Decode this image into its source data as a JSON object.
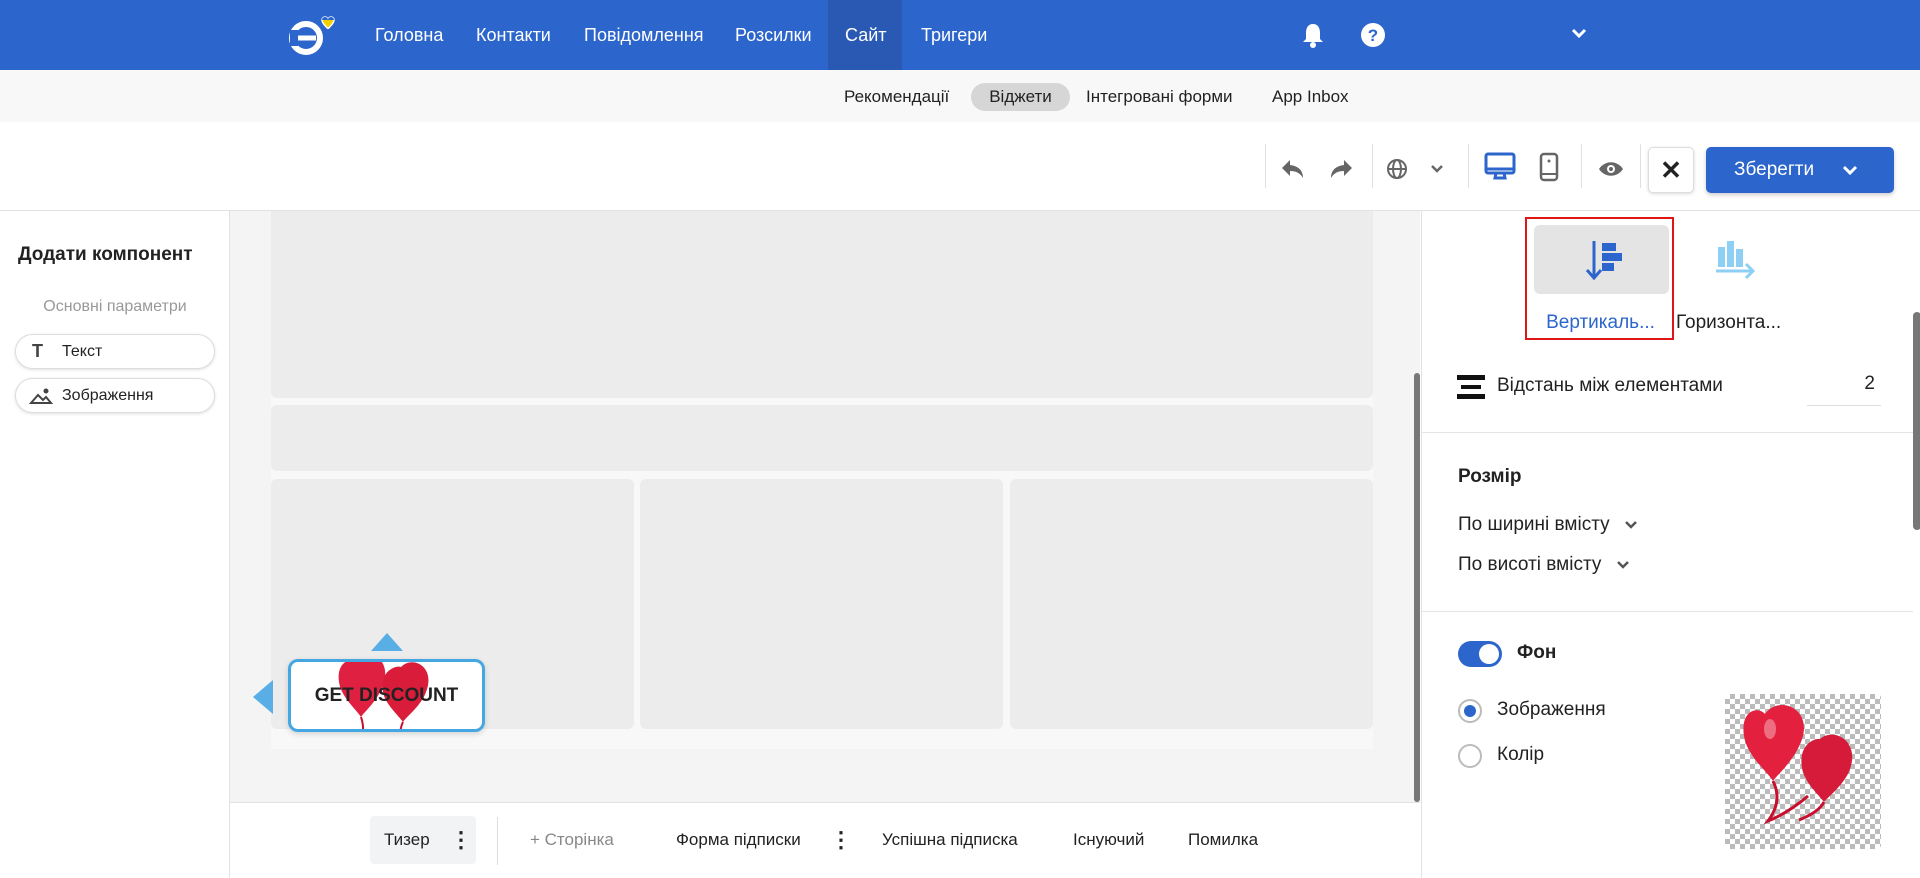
{
  "topnav": {
    "items": [
      "Головна",
      "Контакти",
      "Повідомлення",
      "Розсилки",
      "Сайт",
      "Тригери"
    ],
    "active": "Сайт",
    "brand_color": "#2c65cb"
  },
  "subnav": {
    "items": [
      "Рекомендації",
      "Віджети",
      "Інтегровані форми",
      "App Inbox"
    ],
    "active": "Віджети"
  },
  "toolbar": {
    "save_label": "Зберегти",
    "icons": [
      "undo-icon",
      "redo-icon",
      "globe-icon",
      "desktop-icon",
      "mobile-icon",
      "eye-icon",
      "close-icon"
    ]
  },
  "left": {
    "title": "Додати компонент",
    "section": "Основні параметри",
    "components": [
      "Текст",
      "Зображення"
    ]
  },
  "canvas": {
    "teaser_text": "GET DISCOUNT"
  },
  "bottom": {
    "tabs": [
      "Тизер",
      "+ Сторінка",
      "Форма підписки",
      "Успішна підписка",
      "Існуючий",
      "Помилка"
    ]
  },
  "right": {
    "layout_options": [
      "Вертикаль...",
      "Горизонта..."
    ],
    "spacing_label": "Відстань між елементами",
    "spacing_value": "2",
    "size_title": "Розмір",
    "width_option": "По ширині вмісту",
    "height_option": "По висоті вмісту",
    "bg_label": "Фон",
    "bg_enabled": true,
    "bg_options": [
      "Зображення",
      "Колір"
    ],
    "bg_selected": "Зображення"
  }
}
